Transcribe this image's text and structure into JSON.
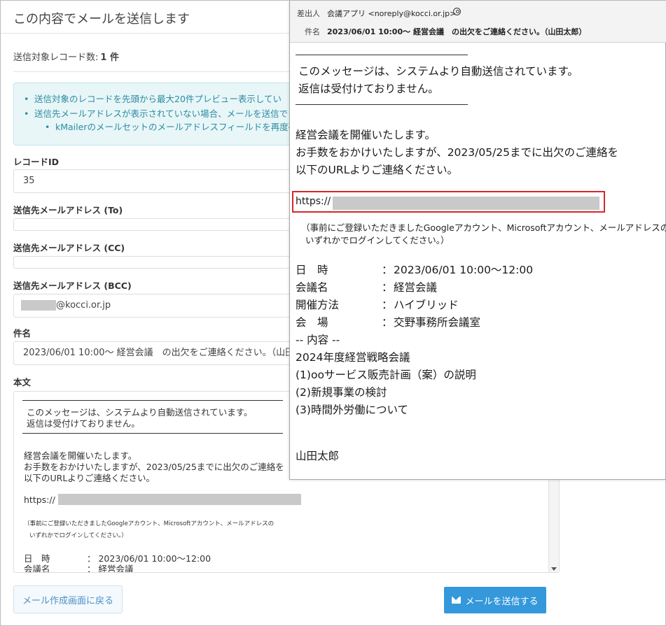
{
  "dialog": {
    "title": "この内容でメールを送信します",
    "record_count_label": "送信対象レコード数:",
    "record_count_value": "1 件",
    "info_items": [
      "送信対象のレコードを先頭から最大20件プレビュー表示してい",
      "送信先メールアドレスが表示されていない場合、メールを送信で",
      "kMailerのメールセットのメールアドレスフィールドを再度確"
    ],
    "fields": {
      "record_id_label": "レコードID",
      "record_id_value": "35",
      "to_label": "送信先メールアドレス (To)",
      "to_value": "",
      "cc_label": "送信先メールアドレス (CC)",
      "cc_value": "",
      "bcc_label": "送信先メールアドレス (BCC)",
      "bcc_value": "@kocci.or.jp",
      "subject_label": "件名",
      "subject_value": "2023/06/01 10:00～ 経営会議　の出欠をご連絡ください。（山田",
      "body_label": "本文"
    },
    "body_preview": {
      "auto_line1": "このメッセージは、システムより自動送信されています。",
      "auto_line2": "返信は受付けておりません。",
      "line1": "経営会議を開催いたします。",
      "line2": "お手数をおかけいたしますが、2023/05/25までに出欠のご連絡を",
      "line3": "以下のURLよりご連絡ください。",
      "url_prefix": "https://",
      "note1": "（事前にご登録いただきましたGoogleアカウント、Microsoftアカウント、メールアドレスの",
      "note2": "いずれかでログインしてください。）",
      "sched1_key": "日　時",
      "sched1_val": "：  2023/06/01 10:00～12:00",
      "sched2_key": "会議名",
      "sched2_val": "：  経営会議"
    },
    "back_button": "メール作成画面に戻る",
    "send_button": "メールを送信する"
  },
  "mail_preview": {
    "from_label": "差出人",
    "from_value": "会議アプリ <noreply@kocci.or.jp>",
    "subject_label": "件名",
    "subject_value": "2023/06/01 10:00～ 経営会議　の出欠をご連絡ください。（山田太郎）",
    "auto_line1": "このメッセージは、システムより自動送信されています。",
    "auto_line2": "返信は受付けておりません。",
    "body_line1": "経営会議を開催いたします。",
    "body_line2": "お手数をおかけいたしますが、2023/05/25までに出欠のご連絡を",
    "body_line3": "以下のURLよりご連絡ください。",
    "url_prefix": "https://",
    "note_line1": "（事前にご登録いただきましたGoogleアカウント、Microsoftアカウント、メールアドレスの",
    "note_line2": "いずれかでログインしてください。）",
    "schedule": [
      {
        "key": "日　時",
        "value": "2023/06/01 10:00～12:00"
      },
      {
        "key": "会議名",
        "value": "経営会議"
      },
      {
        "key": "開催方法",
        "value": "ハイブリッド"
      },
      {
        "key": "会　場",
        "value": "交野事務所会議室"
      }
    ],
    "colon": "：",
    "content_header": "-- 内容 --",
    "content_lines": [
      "2024年度経営戦略会議",
      "(1)ooサービス販売計画（案）の説明",
      "(2)新規事業の検討",
      "(3)時間外労働について"
    ],
    "signature": "山田太郎"
  },
  "colors": {
    "accent": "#3498db",
    "info_text": "#2b8ba0",
    "highlight_border": "#d8262b",
    "redaction": "#c9c9c9"
  }
}
